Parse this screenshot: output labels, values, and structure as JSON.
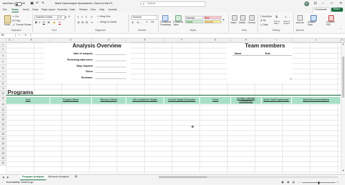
{
  "titlebar": {
    "autosave_label": "AutoSave",
    "autosave_state": "Off",
    "doc_title": "Blank Data Analysis Spreadsheet • Saved to this PC",
    "search_placeholder": "Search",
    "user_initials": "KC"
  },
  "menu": {
    "tabs": [
      "File",
      "Home",
      "Insert",
      "Draw",
      "Page Layout",
      "Formulas",
      "Data",
      "Review",
      "View",
      "Help",
      "Acrobat"
    ],
    "active_tab": "Home",
    "comments_label": "Comments",
    "share_label": "Share"
  },
  "ribbon": {
    "paste_label": "Paste",
    "cut_label": "Cut",
    "copy_label": "Copy",
    "format_painter_label": "Format Painter",
    "font_name": "Franklin Gothic ...",
    "font_size": "11",
    "wrap_text_label": "Wrap Text",
    "merge_center_label": "Merge & Center",
    "number_format": "General",
    "conditional_formatting_label": "Conditional Formatting",
    "format_as_table_label": "Format as Table",
    "styles": {
      "normal": "Normal",
      "bad": "Bad",
      "good": "Good",
      "neutral": "Neutral"
    },
    "insert_label": "Insert",
    "delete_label": "Delete",
    "format_label": "Format",
    "autosum_label": "AutoSum",
    "fill_label": "Fill",
    "clear_label": "Clear",
    "sort_filter_label": "Sort & Filter",
    "find_select_label": "Find & Select",
    "addins_label": "Add-ins",
    "analyze_data_label": "Analyze Data",
    "create_pdf_label": "Create a PDF",
    "groups": {
      "clipboard": "Clipboard",
      "font": "Font",
      "alignment": "Alignment",
      "number": "Number",
      "styles": "Styles",
      "cells": "Cells",
      "editing": "Editing",
      "addins": "Add-ins"
    }
  },
  "formula_bar": {
    "name_box": "B1",
    "fx": "fx"
  },
  "columns": [
    "A",
    "B",
    "C",
    "D",
    "E",
    "F",
    "G",
    "H",
    "I",
    "J",
    "K"
  ],
  "rows": [
    "1",
    "2",
    "3",
    "4",
    "5",
    "6",
    "7",
    "8",
    "9",
    "10",
    "11",
    "12",
    "13",
    "14",
    "15",
    "16",
    "17",
    "18",
    "19",
    "20",
    "21",
    "22",
    "23",
    "24"
  ],
  "sheet": {
    "analysis_title": "Analysis Overview",
    "fields": [
      "Date of analysis:",
      "Reviewing data since:",
      "Days elapsed:",
      "Client:",
      "Reviewer:"
    ],
    "team_title": "Team members",
    "team_headers": [
      "Name",
      "Role"
    ],
    "programs_title": "Programs",
    "programs_headers": [
      "Goal",
      "Program Name",
      "Memory Criteria",
      "List of Mastered Targets",
      "Current Target Description",
      "Trend",
      "Is Data Collected Consistently?",
      "Is the Goal Progressing?",
      "Notes/Recommendations"
    ]
  },
  "sheet_tabs": [
    "Program Analysis",
    "Behavior Analysis"
  ],
  "active_sheet": "Program Analysis",
  "status": {
    "accessibility": "Accessibility: Good to go"
  },
  "colors": {
    "accent": "#1e6f43",
    "table_header": "#a7e0c4",
    "bad_fill": "#ffc7ce",
    "good_fill": "#c6efce",
    "neutral_fill": "#ffeb9c"
  }
}
